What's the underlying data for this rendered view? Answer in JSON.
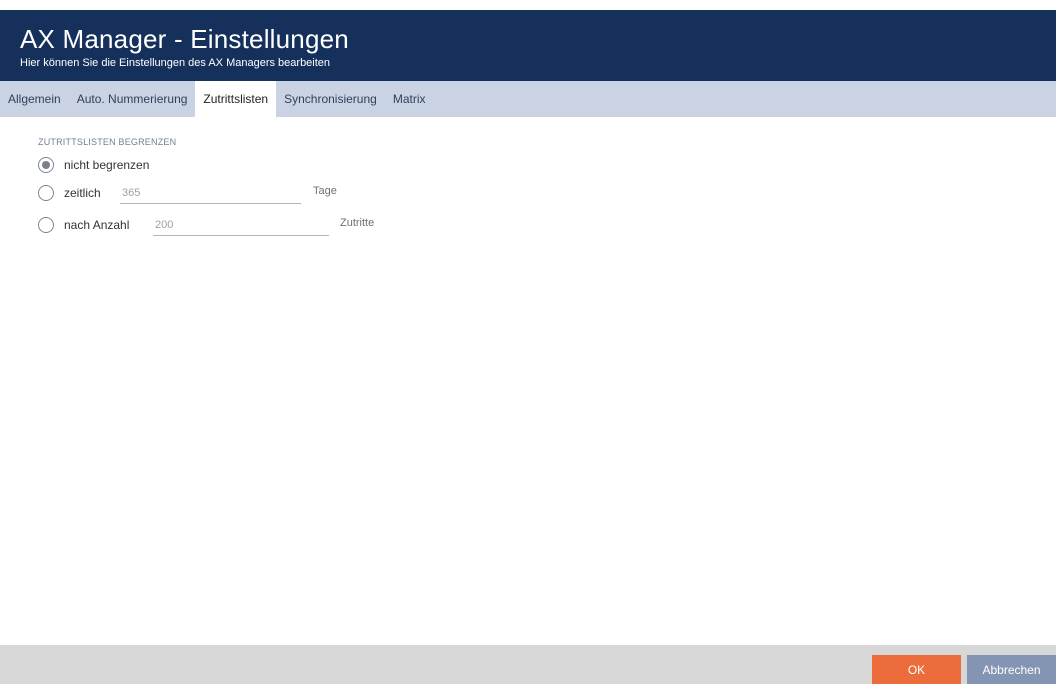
{
  "header": {
    "title": "AX Manager - Einstellungen",
    "subtitle": "Hier können Sie die Einstellungen des AX Managers bearbeiten"
  },
  "tabs": [
    {
      "label": "Allgemein",
      "active": false
    },
    {
      "label": "Auto. Nummerierung",
      "active": false
    },
    {
      "label": "Zutrittslisten",
      "active": true
    },
    {
      "label": "Synchronisierung",
      "active": false
    },
    {
      "label": "Matrix",
      "active": false
    }
  ],
  "section": {
    "title": "ZUTRITTSLISTEN BEGRENZEN",
    "options": [
      {
        "label": "nicht begrenzen",
        "checked": true
      },
      {
        "label": "zeitlich",
        "checked": false,
        "value": "365",
        "unit": "Tage"
      },
      {
        "label": "nach Anzahl",
        "checked": false,
        "value": "200",
        "unit": "Zutritte"
      }
    ]
  },
  "footer": {
    "ok_label": "OK",
    "cancel_label": "Abbrechen"
  },
  "colors": {
    "header_bg": "#16305c",
    "tabbar_bg": "#c9d3e3",
    "ok_bg": "#ec6c3c",
    "cancel_bg": "#8494b3",
    "footer_bg": "#d7d7d7"
  }
}
